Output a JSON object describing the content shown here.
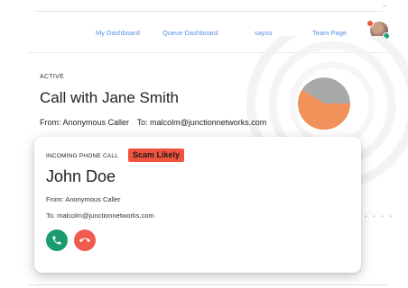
{
  "nav": {
    "items": [
      "My Dashboard",
      "Queue Dashboard",
      "sayso",
      "Team Page"
    ]
  },
  "user": {
    "avatar_icon": "user-avatar",
    "notification_color": "#e8593f",
    "status_color": "#1aa37a"
  },
  "active_call": {
    "status_label": "ACTIVE",
    "title": "Call with Jane Smith",
    "from": "From: Anonymous Caller",
    "to": "To: malcolm@junctionnetworks.com",
    "chart_colors": [
      "#a9a9a9",
      "#f0925a"
    ]
  },
  "incoming_call": {
    "label": "INCOMING PHONE CALL",
    "badge": "Scam Likely",
    "badge_color": "#f0533e",
    "caller_name": "John Doe",
    "from": "From: Anonymous Caller",
    "to": "To: malcolm@junctionnetworks.com",
    "answer_icon": "phone-icon",
    "answer_color": "#1c9b72",
    "decline_icon": "hang-up-icon",
    "decline_color": "#ef5b4f"
  }
}
